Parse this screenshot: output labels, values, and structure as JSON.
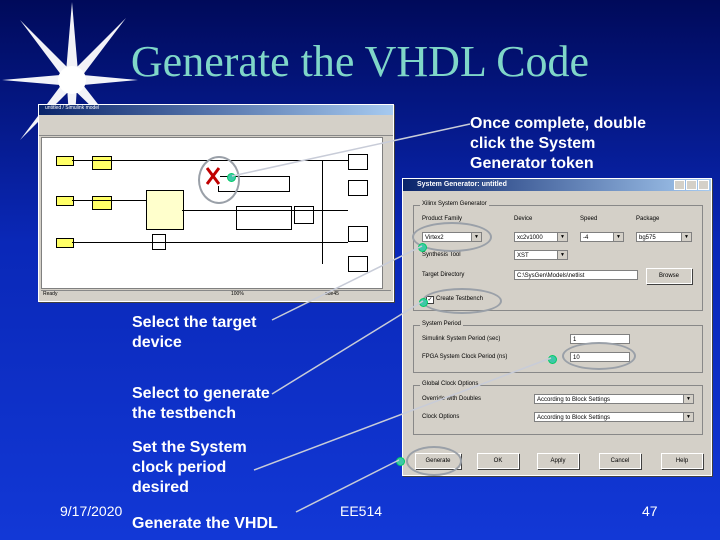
{
  "slide": {
    "title": "Generate the VHDL Code",
    "callout_top": [
      "Once complete, double",
      "click the System",
      "Generator token"
    ],
    "callout_target": [
      "Select the target",
      "device"
    ],
    "callout_testbench": [
      "Select to generate",
      "the testbench"
    ],
    "callout_clock": [
      "Set the System",
      "clock period",
      "desired"
    ],
    "callout_generate": "Generate the VHDL",
    "footer_date": "9/17/2020",
    "footer_course": "EE514",
    "footer_page": "47"
  },
  "simulink": {
    "title": "untitled / Simulink model",
    "status_left": "Ready",
    "status_mid": "100%",
    "status_right": "ode45",
    "sysgen_label": "System Generator",
    "note": "Simulink model blocks"
  },
  "dialog": {
    "title": "System Generator: untitled",
    "group_target": "Xilinx System Generator",
    "product_family_label": "Product Family",
    "device_label": "Device",
    "speed_label": "Speed",
    "package_label": "Package",
    "product_family_value": "Virtex2",
    "device_value": "xc2v1000",
    "speed_value": "-4",
    "package_value": "bg575",
    "synthesis_label": "Synthesis Tool",
    "synthesis_value": "XST",
    "target_dir_label": "Target Directory",
    "target_dir_value": "C:\\SysGen\\Models\\netlist",
    "browse_label": "Browse",
    "testbench_label": "Create Testbench",
    "group_period": "System Period",
    "sim_period_label": "Simulink System Period (sec)",
    "sim_period_value": "1",
    "clock_period_label": "FPGA System Clock Period (ns)",
    "clock_period_value": "10",
    "group_clock": "Global Clock Options",
    "override_label": "Override with Doubles",
    "override_value": "According to Block Settings",
    "clock_opt_label": "Clock Options",
    "clock_opt_value": "According to Block Settings",
    "btn_generate": "Generate",
    "btn_ok": "OK",
    "btn_apply": "Apply",
    "btn_cancel": "Cancel",
    "btn_help": "Help"
  },
  "colors": {
    "background": "#0a28b8",
    "title": "#7fd6c8",
    "marker": "#3ec7a8"
  }
}
